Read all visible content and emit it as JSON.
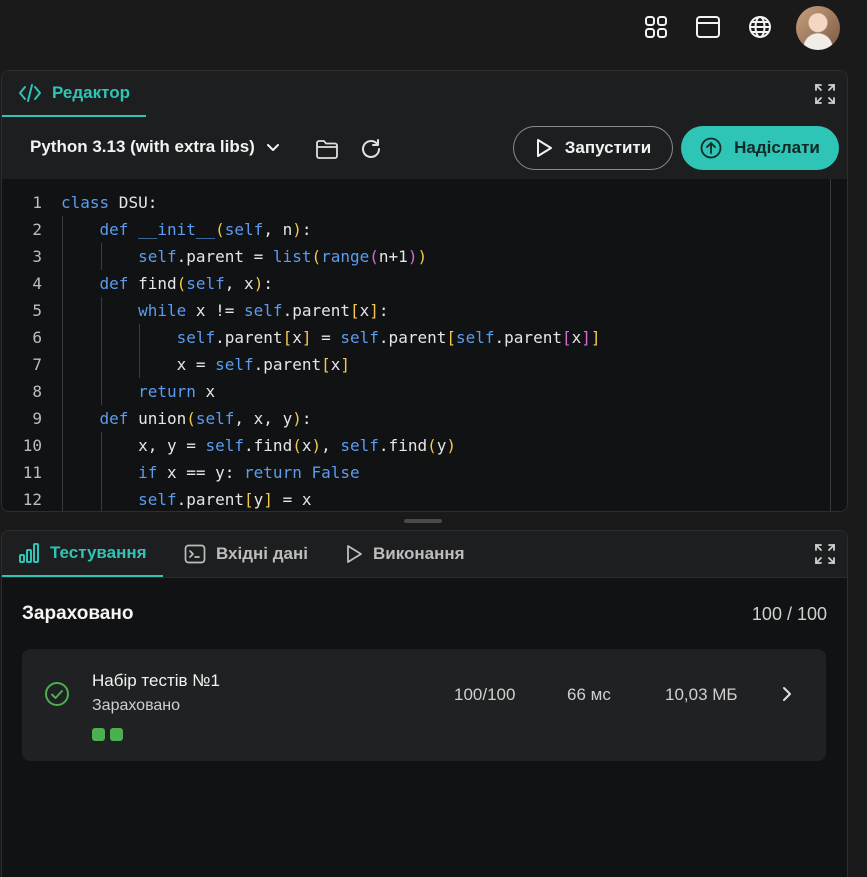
{
  "icons": {
    "grid": "grid-icon",
    "window": "browser-window-icon",
    "globe": "globe-icon",
    "avatar": "user-avatar",
    "code": "code-icon",
    "expand": "expand-icon",
    "chevron": "chevron-down-icon",
    "folder": "folder-icon",
    "reload": "refresh-icon",
    "play": "play-icon",
    "upload": "upload-arrow-icon",
    "chart": "bar-chart-icon",
    "terminal": "terminal-icon",
    "check": "check-circle-icon",
    "next": "chevron-right-icon"
  },
  "colors": {
    "accent": "#2ec4b6",
    "success": "#4caf50",
    "keyword": "#5b9cf0",
    "bracket_outer": "#f2c94c",
    "bracket_inner": "#d66bd6"
  },
  "editor": {
    "tab_label": "Редактор",
    "language": "Python 3.13 (with extra libs)",
    "run_label": "Запустити",
    "submit_label": "Надіслати",
    "lines": [
      {
        "n": "1",
        "html": "<span class='kw'>class</span> DSU:"
      },
      {
        "n": "2",
        "html": "    <span class='kw'>def</span> <span class='kw'>__init__</span><span class='b1'>(</span><span class='kw'>self</span>, n<span class='b1'>)</span>:"
      },
      {
        "n": "3",
        "html": "        <span class='kw'>self</span>.parent = <span class='kw'>list</span><span class='b1'>(</span><span class='kw'>range</span><span class='b2'>(</span>n+1<span class='b2'>)</span><span class='b1'>)</span>"
      },
      {
        "n": "4",
        "html": "    <span class='kw'>def</span> find<span class='b1'>(</span><span class='kw'>self</span>, x<span class='b1'>)</span>:"
      },
      {
        "n": "5",
        "html": "        <span class='kw'>while</span> x != <span class='kw'>self</span>.parent<span class='b1'>[</span>x<span class='b1'>]</span>:"
      },
      {
        "n": "6",
        "html": "            <span class='kw'>self</span>.parent<span class='b1'>[</span>x<span class='b1'>]</span> = <span class='kw'>self</span>.parent<span class='b1'>[</span><span class='kw'>self</span>.parent<span class='b2'>[</span>x<span class='b2'>]</span><span class='b1'>]</span>"
      },
      {
        "n": "7",
        "html": "            x = <span class='kw'>self</span>.parent<span class='b1'>[</span>x<span class='b1'>]</span>"
      },
      {
        "n": "8",
        "html": "        <span class='kw'>return</span> x"
      },
      {
        "n": "9",
        "html": "    <span class='kw'>def</span> union<span class='b1'>(</span><span class='kw'>self</span>, x, y<span class='b1'>)</span>:"
      },
      {
        "n": "10",
        "html": "        x, y = <span class='kw'>self</span>.find<span class='b1'>(</span>x<span class='b1'>)</span>, <span class='kw'>self</span>.find<span class='b1'>(</span>y<span class='b1'>)</span>"
      },
      {
        "n": "11",
        "html": "        <span class='kw'>if</span> x == y: <span class='kw'>return</span> <span class='kw'>False</span>"
      },
      {
        "n": "12",
        "html": "        <span class='kw'>self</span>.parent<span class='b1'>[</span>y<span class='b1'>]</span> = x"
      }
    ]
  },
  "tests": {
    "tabs": [
      "Тестування",
      "Вхідні дані",
      "Виконання"
    ],
    "summary_title": "Зараховано",
    "summary_score": "100 / 100",
    "card": {
      "name": "Набір тестів №1",
      "status": "Зараховано",
      "score": "100/100",
      "time": "66 мс",
      "memory": "10,03 МБ",
      "passed_tests": 2
    }
  }
}
